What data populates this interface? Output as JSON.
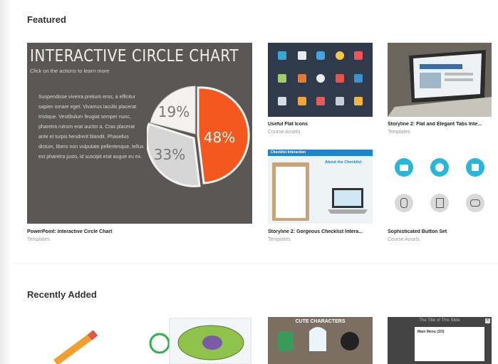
{
  "sections": {
    "featured": "Featured",
    "recent": "Recently Added"
  },
  "featured": {
    "big": {
      "title": "PowerPoint: Interactive Circle Chart",
      "sub": "Templates",
      "slide_title": "INTERACTIVE CIRCLE CHART",
      "slide_sub": "Click on the actions to learn more",
      "slide_body": "Suspendisse viverra pretium eros, a efficitur sapien ornare eget. Vivamus iaculis placerat tristique. Vestibulum feugiat semper nunc, pharetra rutrum erat auctor a. Cras placerat ante et turpis hendrerit blandit. Phasellus dictum, libero non vulputate pellentesque, tellus est pharetra justo, id suscipit erat augue eu ex.",
      "pct_a": "48%",
      "pct_b": "33%",
      "pct_c": "19%"
    },
    "cards": [
      {
        "title": "Useful Flat Icons",
        "sub": "Course Assets"
      },
      {
        "title": "Storyline 2: Flat and Elegant Tabs Inte...",
        "sub": "Templates"
      },
      {
        "title": "Storyline 2: Gorgeous Checklist Intera...",
        "sub": "Templates"
      },
      {
        "title": "Sophisticated Button Set",
        "sub": "Course Assets"
      }
    ],
    "checklist_header": "Checklist Interaction",
    "checklist_about": "About the Checklist"
  },
  "recent": {
    "cute": "CUTE CHARACTERS",
    "slide_title": "The Title of This Slide",
    "menu": "Main Menu (3/3)"
  },
  "colors": {
    "accent_orange": "#f4581e",
    "teal": "#29b6d9"
  }
}
